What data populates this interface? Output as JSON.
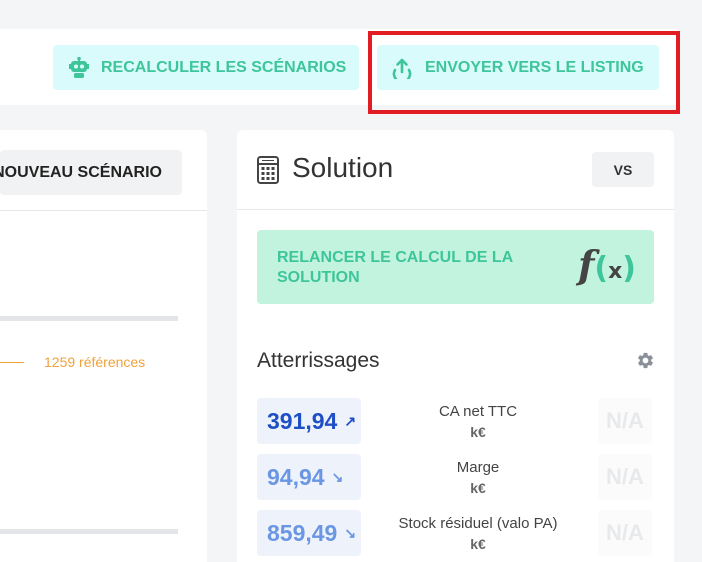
{
  "toolbar": {
    "recalc_label": "RECALCULER LES SCÉNARIOS",
    "send_label": "ENVOYER VERS LE LISTING"
  },
  "left_panel": {
    "new_scenario_label": "NOUVEAU SCÉNARIO",
    "references_text": "1259 références"
  },
  "solution": {
    "title": "Solution",
    "vs_label": "VS",
    "relaunch_label": "RELANCER LE CALCUL DE LA SOLUTION",
    "fx_f": "f",
    "fx_open": "(",
    "fx_x": "x",
    "fx_close": ")"
  },
  "atterrissages": {
    "title": "Atterrissages",
    "metrics": [
      {
        "value": "391,94",
        "arrow": "↗",
        "label": "CA net TTC",
        "unit": "k€",
        "compare": "N/A",
        "color": "#1e4fc7"
      },
      {
        "value": "94,94",
        "arrow": "↘",
        "label": "Marge",
        "unit": "k€",
        "compare": "N/A",
        "color": "#6b96e4"
      },
      {
        "value": "859,49",
        "arrow": "↘",
        "label": "Stock résiduel (valo PA)",
        "unit": "k€",
        "compare": "N/A",
        "color": "#6b96e4"
      }
    ]
  },
  "icons": {
    "recalc": "robot-icon",
    "send": "upload-icon",
    "calculator": "calculator-icon",
    "settings": "gear-icon"
  },
  "colors": {
    "accent": "#3ec59a",
    "highlight": "#e11d23",
    "warning": "#f0a23b"
  }
}
